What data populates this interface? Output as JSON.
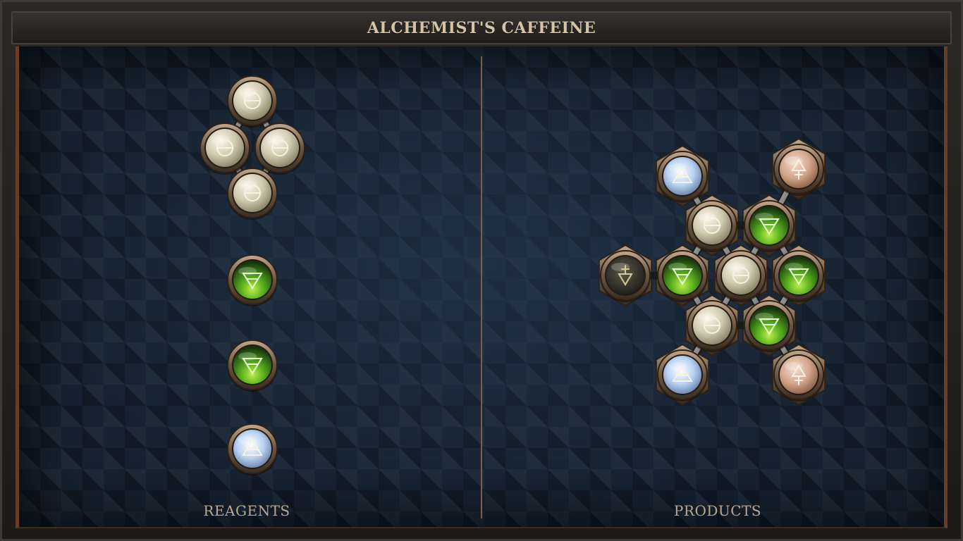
{
  "window": {
    "title": "ALCHEMIST'S CAFFEINE"
  },
  "panels": {
    "reagents_label": "REAGENTS",
    "products_label": "PRODUCTS"
  },
  "element_types": {
    "salt": {
      "color": "#d9d3bd",
      "icon": "salt-symbol-circle-bar"
    },
    "earth": {
      "color": "#5bb523",
      "icon": "earth-symbol-inverted-triangle-bar"
    },
    "air": {
      "color": "#bcd4f2",
      "icon": "air-symbol-triangle-bar"
    },
    "fire": {
      "color": "#d9b19a",
      "icon": "fire-symbol-triangle-cross"
    },
    "dark": {
      "color": "#3b3a2c",
      "icon": "dark-symbol-inverted-triangle-cross"
    }
  },
  "reagents": [
    {
      "name": "reagent-salt-ring",
      "atoms": [
        "salt",
        "salt",
        "salt",
        "salt"
      ]
    },
    {
      "name": "reagent-earth-1",
      "atoms": [
        "earth"
      ]
    },
    {
      "name": "reagent-earth-2",
      "atoms": [
        "earth"
      ]
    },
    {
      "name": "reagent-air",
      "atoms": [
        "air"
      ]
    }
  ],
  "product": {
    "name": "product-molecule",
    "atoms": [
      "air",
      "fire",
      "salt",
      "earth",
      "dark",
      "earth",
      "salt",
      "earth",
      "salt",
      "earth",
      "air",
      "fire"
    ]
  }
}
